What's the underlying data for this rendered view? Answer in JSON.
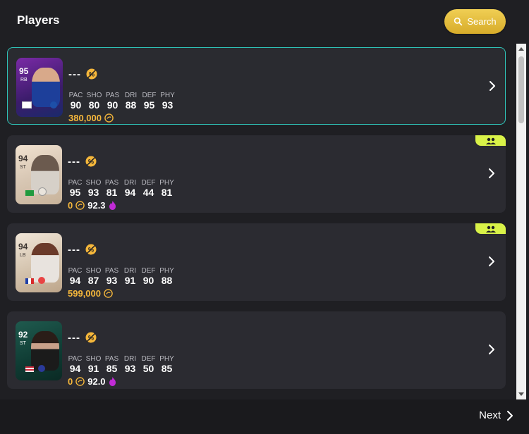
{
  "header": {
    "title": "Players",
    "search_label": "Search"
  },
  "stat_labels": [
    "PAC",
    "SHO",
    "PAS",
    "DRI",
    "DEF",
    "PHY"
  ],
  "players": [
    {
      "name": "---",
      "rating": "95",
      "position": "RB",
      "stats": [
        "90",
        "80",
        "90",
        "88",
        "95",
        "93"
      ],
      "price": "380,000",
      "chem_value": null,
      "selected": true,
      "badge": false
    },
    {
      "name": "---",
      "rating": "94",
      "position": "ST",
      "stats": [
        "95",
        "93",
        "81",
        "94",
        "44",
        "81"
      ],
      "price": "0",
      "chem_value": "92.3",
      "selected": false,
      "badge": true
    },
    {
      "name": "---",
      "rating": "94",
      "position": "LB",
      "stats": [
        "94",
        "87",
        "93",
        "91",
        "90",
        "88"
      ],
      "price": "599,000",
      "chem_value": null,
      "selected": false,
      "badge": true
    },
    {
      "name": "---",
      "rating": "92",
      "position": "ST",
      "stats": [
        "94",
        "91",
        "85",
        "93",
        "50",
        "85"
      ],
      "price": "0",
      "chem_value": "92.0",
      "selected": false,
      "badge": false
    }
  ],
  "footer": {
    "next_label": "Next"
  },
  "colors": {
    "accent": "#2fc2b7",
    "gold": "#f5b73b",
    "badge": "#d9f248"
  }
}
